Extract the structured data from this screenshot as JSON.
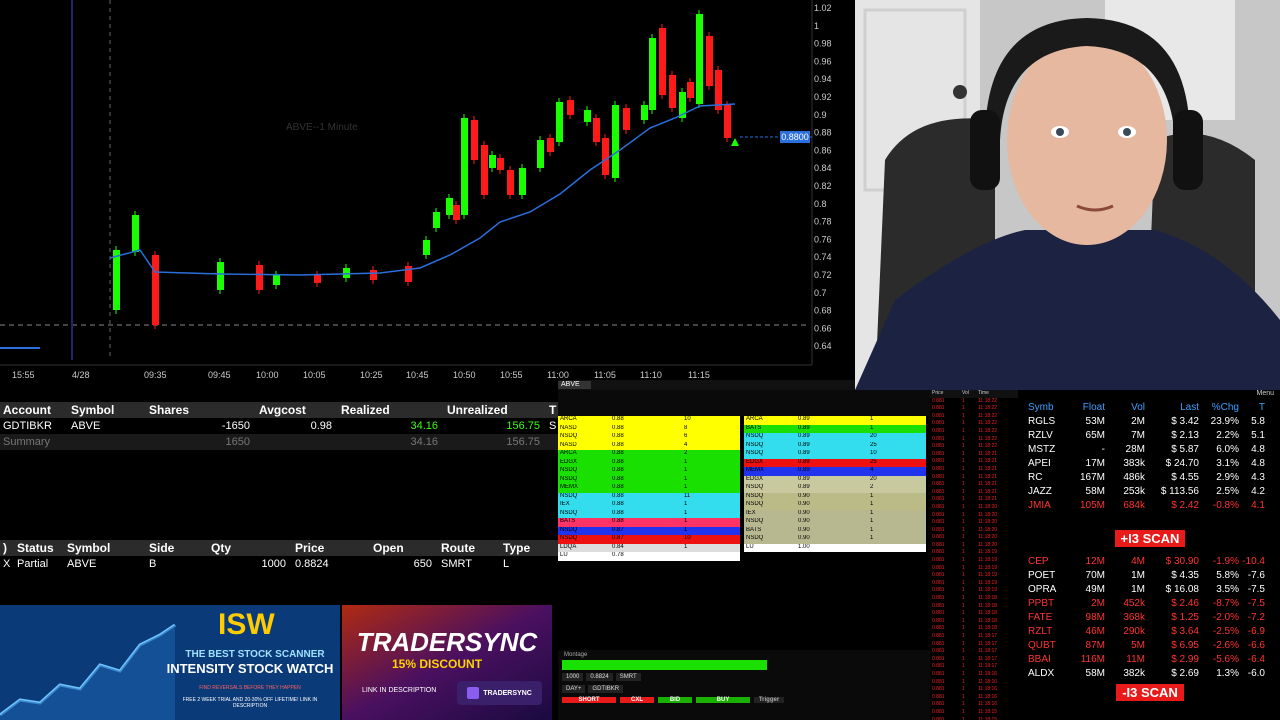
{
  "chart": {
    "title": "ABVE--1 Minute",
    "price_axis": [
      "1.02",
      "1",
      "0.98",
      "0.96",
      "0.94",
      "0.92",
      "0.9",
      "0.88",
      "0.86",
      "0.84",
      "0.82",
      "0.8",
      "0.78",
      "0.76",
      "0.74",
      "0.72",
      "0.7",
      "0.68",
      "0.66",
      "0.64"
    ],
    "time_axis": [
      "15:55",
      "4/28",
      "09:35",
      "09:45",
      "10:00",
      "10:05",
      "10:25",
      "10:45",
      "10:50",
      "10:55",
      "11:00",
      "11:05",
      "11:10",
      "11:15"
    ],
    "price_tag": "0.8800",
    "colors": {
      "up": "#19ff00",
      "down": "#ff1a1a",
      "vwap": "#2a6fdc"
    }
  },
  "positions": {
    "headers": [
      "Account",
      "Symbol",
      "Shares",
      "Avgcost",
      "Realized",
      "Unrealized",
      "T"
    ],
    "rows": [
      {
        "account": "GDTIBKR",
        "symbol": "ABVE",
        "shares": "-1650",
        "avgcost": "0.98",
        "realized": "34.16",
        "unrealized": "156.75",
        "t": "S"
      }
    ],
    "summary": {
      "label": "Summary",
      "shares": "1650",
      "realized": "34.16",
      "unrealized": "156.75"
    }
  },
  "orders": {
    "headers": [
      ")",
      "Status",
      "Symbol",
      "Side",
      "Qty",
      "Price",
      "Open",
      "Route",
      "Type"
    ],
    "rows": [
      {
        "x": "X",
        "status": "Partial",
        "symbol": "ABVE",
        "side": "B",
        "qty": "1000",
        "price": "0.8824",
        "open": "650",
        "route": "SMRT",
        "type": "L"
      }
    ]
  },
  "level2": {
    "symbol": "ABVE",
    "bid_rows": [
      {
        "mm": "ARCA",
        "price": "0.88",
        "size": "10",
        "color": "#ffff00"
      },
      {
        "mm": "NASD",
        "price": "0.88",
        "size": "8",
        "color": "#ffff00"
      },
      {
        "mm": "NSDQ",
        "price": "0.88",
        "size": "6",
        "color": "#ffff00"
      },
      {
        "mm": "NASD",
        "price": "0.88",
        "size": "4",
        "color": "#ffff00"
      },
      {
        "mm": "ARCA",
        "price": "0.88",
        "size": "2",
        "color": "#19e000"
      },
      {
        "mm": "EDGX",
        "price": "0.88",
        "size": "1",
        "color": "#19e000"
      },
      {
        "mm": "NSDQ",
        "price": "0.88",
        "size": "1",
        "color": "#19e000"
      },
      {
        "mm": "NSDQ",
        "price": "0.88",
        "size": "1",
        "color": "#19e000"
      },
      {
        "mm": "MEMX",
        "price": "0.88",
        "size": "1",
        "color": "#19e000"
      },
      {
        "mm": "NSDQ",
        "price": "0.88",
        "size": "11",
        "color": "#33ddee"
      },
      {
        "mm": "IEX",
        "price": "0.88",
        "size": "1",
        "color": "#33ddee"
      },
      {
        "mm": "NSDQ",
        "price": "0.88",
        "size": "1",
        "color": "#33ddee"
      },
      {
        "mm": "BATS",
        "price": "0.88",
        "size": "1",
        "color": "#ff3366"
      },
      {
        "mm": "NSDQ",
        "price": "0.87",
        "size": "1",
        "color": "#2233ee"
      },
      {
        "mm": "NSDQ",
        "price": "0.87",
        "size": "10",
        "color": "#ee1111"
      },
      {
        "mm": "LDQA",
        "price": "0.84",
        "size": "1",
        "color": "#dddddd"
      },
      {
        "mm": "LU",
        "price": "0.78",
        "size": "",
        "color": "#ffffff"
      }
    ],
    "ask_rows": [
      {
        "mm": "ARCA",
        "price": "0.89",
        "size": "1",
        "color": "#ffff00"
      },
      {
        "mm": "BATS",
        "price": "0.89",
        "size": "1",
        "color": "#19e000"
      },
      {
        "mm": "NSDQ",
        "price": "0.89",
        "size": "20",
        "color": "#33ddee"
      },
      {
        "mm": "NSDQ",
        "price": "0.89",
        "size": "25",
        "color": "#33ddee"
      },
      {
        "mm": "NSDQ",
        "price": "0.89",
        "size": "10",
        "color": "#33ddee"
      },
      {
        "mm": "EDGX",
        "price": "0.89",
        "size": "25",
        "color": "#ee1111"
      },
      {
        "mm": "MEMX",
        "price": "0.89",
        "size": "4",
        "color": "#2233ee"
      },
      {
        "mm": "EDGX",
        "price": "0.89",
        "size": "20",
        "color": "#c9c9a0"
      },
      {
        "mm": "NSDQ",
        "price": "0.89",
        "size": "2",
        "color": "#c9c9a0"
      },
      {
        "mm": "NSDQ",
        "price": "0.90",
        "size": "1",
        "color": "#bbbb88"
      },
      {
        "mm": "NSDQ",
        "price": "0.90",
        "size": "1",
        "color": "#bbbb88"
      },
      {
        "mm": "IEX",
        "price": "0.90",
        "size": "1",
        "color": "#b8b890"
      },
      {
        "mm": "NSDQ",
        "price": "0.90",
        "size": "1",
        "color": "#b8b890"
      },
      {
        "mm": "BATS",
        "price": "0.90",
        "size": "1",
        "color": "#b8b890"
      },
      {
        "mm": "NSDQ",
        "price": "0.90",
        "size": "1",
        "color": "#b8b890"
      },
      {
        "mm": "LU",
        "price": "1.00",
        "size": "",
        "color": "#ffffff"
      }
    ],
    "montage_label": "Montage",
    "qty": "1000",
    "limit_price": "0.8824",
    "route": "SMRT",
    "account": "GDTIBKR",
    "tif": "DAY+",
    "buttons": {
      "short": "SHORT",
      "cxl": "CXL",
      "buy_bid": "BID",
      "buy": "BUY",
      "trigger": "Trigger"
    }
  },
  "time_sales": {
    "headers": [
      "Price",
      "Vol",
      "Time"
    ],
    "rows": [
      {
        "p": "0.881",
        "v": "1",
        "t": "11:18:22"
      },
      {
        "p": "0.881",
        "v": "1",
        "t": "11:18:22"
      },
      {
        "p": "0.881",
        "v": "1",
        "t": "11:18:22"
      },
      {
        "p": "0.881",
        "v": "1",
        "t": "11:18:22"
      },
      {
        "p": "0.881",
        "v": "1",
        "t": "11:18:22"
      },
      {
        "p": "0.881",
        "v": "1",
        "t": "11:18:22"
      },
      {
        "p": "0.881",
        "v": "1",
        "t": "11:18:22"
      },
      {
        "p": "0.881",
        "v": "1",
        "t": "11:18:21"
      },
      {
        "p": "0.881",
        "v": "1",
        "t": "11:18:21"
      },
      {
        "p": "0.881",
        "v": "1",
        "t": "11:18:21"
      },
      {
        "p": "0.881",
        "v": "1",
        "t": "11:18:21"
      },
      {
        "p": "0.881",
        "v": "1",
        "t": "11:18:21"
      },
      {
        "p": "0.881",
        "v": "1",
        "t": "11:18:21"
      },
      {
        "p": "0.881",
        "v": "1",
        "t": "11:18:21"
      },
      {
        "p": "0.881",
        "v": "1",
        "t": "11:18:20"
      },
      {
        "p": "0.881",
        "v": "1",
        "t": "11:18:20"
      },
      {
        "p": "0.881",
        "v": "1",
        "t": "11:18:20"
      },
      {
        "p": "0.881",
        "v": "1",
        "t": "11:18:20"
      },
      {
        "p": "0.881",
        "v": "1",
        "t": "11:18:20"
      },
      {
        "p": "0.881",
        "v": "1",
        "t": "11:18:20"
      },
      {
        "p": "0.881",
        "v": "1",
        "t": "11:18:19"
      },
      {
        "p": "0.881",
        "v": "1",
        "t": "11:18:19"
      },
      {
        "p": "0.881",
        "v": "1",
        "t": "11:18:19"
      },
      {
        "p": "0.881",
        "v": "1",
        "t": "11:18:19"
      },
      {
        "p": "0.881",
        "v": "1",
        "t": "11:18:19"
      },
      {
        "p": "0.881",
        "v": "1",
        "t": "11:18:19"
      },
      {
        "p": "0.881",
        "v": "1",
        "t": "11:18:18"
      },
      {
        "p": "0.881",
        "v": "1",
        "t": "11:18:18"
      },
      {
        "p": "0.881",
        "v": "1",
        "t": "11:18:18"
      },
      {
        "p": "0.881",
        "v": "1",
        "t": "11:18:18"
      },
      {
        "p": "0.881",
        "v": "1",
        "t": "11:18:18"
      },
      {
        "p": "0.881",
        "v": "1",
        "t": "11:18:17"
      },
      {
        "p": "0.881",
        "v": "1",
        "t": "11:18:17"
      },
      {
        "p": "0.881",
        "v": "1",
        "t": "11:18:17"
      },
      {
        "p": "0.881",
        "v": "1",
        "t": "11:18:17"
      },
      {
        "p": "0.881",
        "v": "1",
        "t": "11:18:17"
      },
      {
        "p": "0.881",
        "v": "1",
        "t": "11:18:16"
      },
      {
        "p": "0.881",
        "v": "1",
        "t": "11:18:16"
      },
      {
        "p": "0.881",
        "v": "1",
        "t": "11:18:16"
      },
      {
        "p": "0.881",
        "v": "1",
        "t": "11:18:16"
      },
      {
        "p": "0.881",
        "v": "1",
        "t": "11:18:16"
      },
      {
        "p": "0.881",
        "v": "1",
        "t": "11:18:15"
      },
      {
        "p": "0.881",
        "v": "1",
        "t": "11:18:15"
      }
    ]
  },
  "scanner": {
    "menu": "Menu",
    "headers": [
      "Symb",
      "Float",
      "Vol",
      "Last",
      "%Chg",
      "T"
    ],
    "top_rows": [
      {
        "s": "RGLS",
        "f": "53M",
        "v": "2M",
        "l": "$ 3.42",
        "c": "23.9%",
        "t": "5.8",
        "color": "#ffffff"
      },
      {
        "s": "RZLV",
        "f": "65M",
        "v": "7M",
        "l": "$ 2.13",
        "c": "2.2%",
        "t": "5.1",
        "color": "#ffffff"
      },
      {
        "s": "MSTZ",
        "f": "-",
        "v": "28M",
        "l": "$ 5.87",
        "c": "6.0%",
        "t": "4.8",
        "color": "#ffffff"
      },
      {
        "s": "APEI",
        "f": "17M",
        "v": "383k",
        "l": "$ 24.70",
        "c": "3.1%",
        "t": "4.8",
        "color": "#ffffff"
      },
      {
        "s": "RC",
        "f": "167M",
        "v": "486k",
        "l": "$ 4.55",
        "c": "2.9%",
        "t": "4.3",
        "color": "#ffffff"
      },
      {
        "s": "JAZZ",
        "f": "58M",
        "v": "253k",
        "l": "$ 113.56",
        "c": "2.5%",
        "t": "4.2",
        "color": "#ffffff"
      },
      {
        "s": "JMIA",
        "f": "105M",
        "v": "684k",
        "l": "$ 2.42",
        "c": "-0.8%",
        "t": "4.1",
        "color": "#ff3333"
      }
    ],
    "badge_top": "+I3 SCAN",
    "bottom_rows": [
      {
        "s": "CEP",
        "f": "12M",
        "v": "4M",
        "l": "$ 30.90",
        "c": "-1.9%",
        "t": "-10.4",
        "color": "#ff3333"
      },
      {
        "s": "POET",
        "f": "70M",
        "v": "1M",
        "l": "$ 4.35",
        "c": "5.8%",
        "t": "-7.6",
        "color": "#ffffff"
      },
      {
        "s": "OPRA",
        "f": "49M",
        "v": "1M",
        "l": "$ 16.08",
        "c": "3.5%",
        "t": "-7.5",
        "color": "#ffffff"
      },
      {
        "s": "PPBT",
        "f": "2M",
        "v": "452k",
        "l": "$ 2.46",
        "c": "-8.7%",
        "t": "-7.5",
        "color": "#ff3333"
      },
      {
        "s": "FATE",
        "f": "98M",
        "v": "368k",
        "l": "$ 1.25",
        "c": "-2.0%",
        "t": "-7.2",
        "color": "#ff3333"
      },
      {
        "s": "RZLT",
        "f": "46M",
        "v": "290k",
        "l": "$ 3.64",
        "c": "-2.5%",
        "t": "-6.9",
        "color": "#ff3333"
      },
      {
        "s": "QUBT",
        "f": "87M",
        "v": "5M",
        "l": "$ 6.95",
        "c": "-2.6%",
        "t": "-6.6",
        "color": "#ff3333"
      },
      {
        "s": "BBAI",
        "f": "116M",
        "v": "11M",
        "l": "$ 2.99",
        "c": "-5.6%",
        "t": "-6.4",
        "color": "#ff3333"
      },
      {
        "s": "ALDX",
        "f": "58M",
        "v": "382k",
        "l": "$ 2.69",
        "c": "1.3%",
        "t": "-6.0",
        "color": "#ffffff"
      }
    ],
    "badge_bottom": "-I3 SCAN"
  },
  "ads": {
    "isw": {
      "logo": "ISW",
      "tagline": "THE BEST STOCK SCANNER",
      "name": "INTENSITY STOCK WATCH",
      "sub": "FIND REVERSALS BEFORE THEY HAPPEN",
      "offer": "FREE 2 WEEK TRIAL AND 20-30% OFF LIFETIME! LINK IN DESCRIPTION"
    },
    "tradersync": {
      "name": "TRADERSYNC",
      "discount": "15% DISCOUNT",
      "link": "LINK IN DESCRIPTION",
      "brand": "TRADERSYNC"
    }
  }
}
